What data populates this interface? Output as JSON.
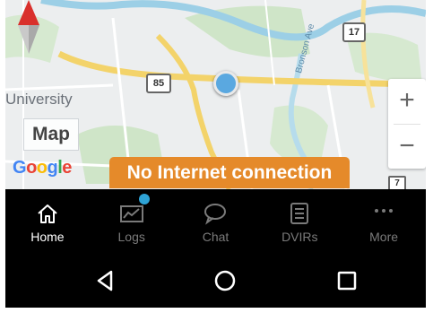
{
  "map": {
    "place_label": "University",
    "map_type_label": "Map",
    "route_shields": [
      "85",
      "17"
    ],
    "street_label": "Bronson Ave",
    "google_logo": [
      "G",
      "o",
      "o",
      "g",
      "l",
      "e"
    ],
    "google_colors": [
      "#4285f4",
      "#ea4335",
      "#fbbc05",
      "#4285f4",
      "#34a853",
      "#ea4335"
    ],
    "zoom_in": "+",
    "zoom_out": "−",
    "edge_shield": "7"
  },
  "banner": {
    "text": "No Internet connection",
    "color": "#e58a2a"
  },
  "nav": {
    "items": [
      {
        "label": "Home",
        "icon": "home-icon",
        "active": true
      },
      {
        "label": "Logs",
        "icon": "chart-icon",
        "active": false
      },
      {
        "label": "Chat",
        "icon": "chat-bubble-icon",
        "active": false
      },
      {
        "label": "DVIRs",
        "icon": "checklist-icon",
        "active": false
      },
      {
        "label": "More",
        "icon": "more-dots-icon",
        "active": false
      }
    ],
    "badge_color": "#2ea3d6"
  },
  "system_bar": {
    "buttons": [
      "back-icon",
      "home-circle-icon",
      "recents-icon"
    ]
  }
}
